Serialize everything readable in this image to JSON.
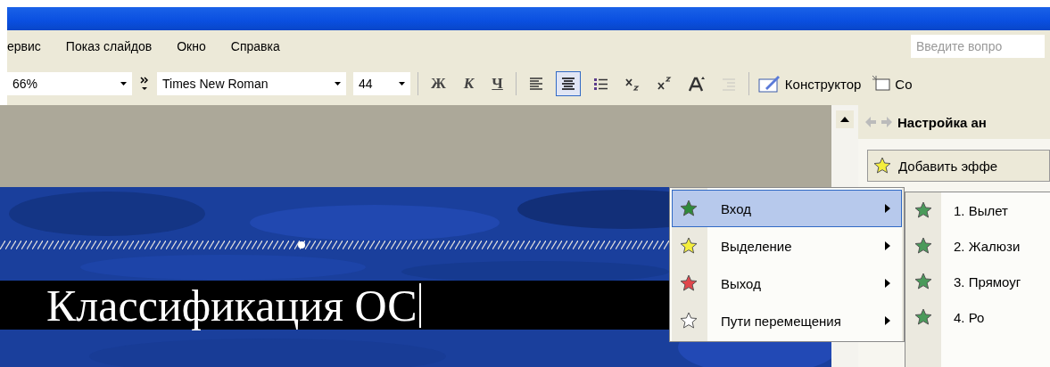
{
  "menu_bar": {
    "items": [
      "ервис",
      "Показ слайдов",
      "Окно",
      "Справка"
    ],
    "help_field": {
      "placeholder": "Введите вопро"
    }
  },
  "toolbar": {
    "zoom": "66%",
    "font": "Times New Roman",
    "size": "44",
    "format_buttons": [
      {
        "label": "Ж",
        "kind": "bold"
      },
      {
        "label": "К",
        "kind": "italic"
      },
      {
        "label": "Ч",
        "kind": "underline"
      }
    ],
    "tools": [
      {
        "kind": "align-left",
        "selected": false,
        "disabled": false
      },
      {
        "kind": "align-center",
        "selected": true,
        "disabled": false
      },
      {
        "kind": "bullets",
        "selected": false,
        "disabled": false
      },
      {
        "kind": "subscript",
        "selected": false,
        "disabled": false
      },
      {
        "kind": "superscript",
        "selected": false,
        "disabled": false
      },
      {
        "kind": "grow-font",
        "selected": false,
        "disabled": false
      },
      {
        "kind": "demote",
        "selected": false,
        "disabled": true
      }
    ],
    "designer": "Конструктор",
    "new_slide": "Со"
  },
  "slide": {
    "title": "Классификация ОС"
  },
  "task_pane": {
    "title": "Настройка ан",
    "add_effect": "Добавить эффе"
  },
  "effect_menu": [
    {
      "label": "Вход",
      "color": "#2f8a3a",
      "selected": true
    },
    {
      "label": "Выделение",
      "color": "#f4ee3c",
      "selected": false
    },
    {
      "label": "Выход",
      "color": "#e0464c",
      "selected": false
    },
    {
      "label": "Пути перемещения",
      "color": "#ffffff",
      "selected": false
    }
  ],
  "entrance_submenu": [
    "1. Вылет",
    "2. Жалюзи",
    "3. Прямоуг",
    "4. Ро"
  ]
}
